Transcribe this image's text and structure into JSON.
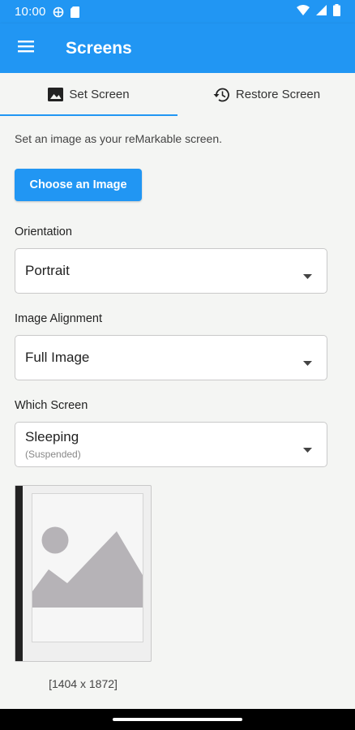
{
  "status_bar": {
    "time": "10:00",
    "icons": [
      "sync-icon",
      "sd-card-icon",
      "wifi-icon",
      "signal-icon",
      "battery-icon"
    ]
  },
  "app_bar": {
    "title": "Screens",
    "menu_icon": "hamburger-menu-icon",
    "color": "#2196f3"
  },
  "tabs": [
    {
      "label": "Set Screen",
      "icon": "image-icon",
      "active": true
    },
    {
      "label": "Restore Screen",
      "icon": "history-icon",
      "active": false
    }
  ],
  "main": {
    "description": "Set an image as your reMarkable screen.",
    "choose_button": "Choose an Image",
    "orientation": {
      "label": "Orientation",
      "value": "Portrait"
    },
    "alignment": {
      "label": "Image Alignment",
      "value": "Full Image"
    },
    "which_screen": {
      "label": "Which Screen",
      "value": "Sleeping",
      "subtitle": "(Suspended)"
    },
    "preview": {
      "placeholder_icon": "image-placeholder-icon",
      "dimensions": "[1404 x 1872]"
    }
  },
  "accent_color": "#2196f3"
}
